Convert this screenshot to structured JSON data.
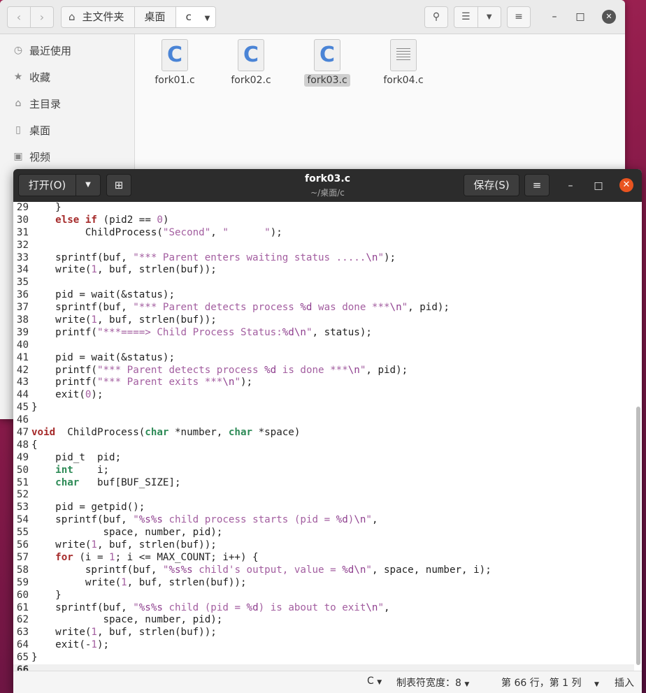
{
  "file_manager": {
    "path": [
      "主文件夹",
      "桌面",
      "c"
    ],
    "sidebar": [
      {
        "label": "最近使用",
        "icon": "clock-icon"
      },
      {
        "label": "收藏",
        "icon": "star-icon"
      },
      {
        "label": "主目录",
        "icon": "home-icon"
      },
      {
        "label": "桌面",
        "icon": "desktop-icon"
      },
      {
        "label": "视频",
        "icon": "video-icon"
      }
    ],
    "files": [
      {
        "name": "fork01.c",
        "type": "c"
      },
      {
        "name": "fork02.c",
        "type": "c"
      },
      {
        "name": "fork03.c",
        "type": "c",
        "selected": true
      },
      {
        "name": "fork04.c",
        "type": "text"
      }
    ]
  },
  "editor": {
    "open_label": "打开(O)",
    "save_label": "保存(S)",
    "title": "fork03.c",
    "subtitle": "~/桌面/c",
    "status": {
      "language": "C",
      "tab_width": "制表符宽度：8",
      "position": "第 66 行，第 1 列",
      "mode": "插入"
    },
    "lines": [
      {
        "n": "29",
        "code": "    }"
      },
      {
        "n": "30",
        "code": "    else if (pid2 == 0)"
      },
      {
        "n": "31",
        "code": "         ChildProcess(\"Second\", \"      \");"
      },
      {
        "n": "32",
        "code": ""
      },
      {
        "n": "33",
        "code": "    sprintf(buf, \"*** Parent enters waiting status .....\\n\");"
      },
      {
        "n": "34",
        "code": "    write(1, buf, strlen(buf));"
      },
      {
        "n": "35",
        "code": ""
      },
      {
        "n": "36",
        "code": "    pid = wait(&status);"
      },
      {
        "n": "37",
        "code": "    sprintf(buf, \"*** Parent detects process %d was done ***\\n\", pid);"
      },
      {
        "n": "38",
        "code": "    write(1, buf, strlen(buf));"
      },
      {
        "n": "39",
        "code": "    printf(\"***====> Child Process Status:%d\\n\", status);"
      },
      {
        "n": "40",
        "code": ""
      },
      {
        "n": "41",
        "code": "    pid = wait(&status);"
      },
      {
        "n": "42",
        "code": "    printf(\"*** Parent detects process %d is done ***\\n\", pid);"
      },
      {
        "n": "43",
        "code": "    printf(\"*** Parent exits ***\\n\");"
      },
      {
        "n": "44",
        "code": "    exit(0);"
      },
      {
        "n": "45",
        "code": "}"
      },
      {
        "n": "46",
        "code": ""
      },
      {
        "n": "47",
        "code": "void  ChildProcess(char *number, char *space)"
      },
      {
        "n": "48",
        "code": "{"
      },
      {
        "n": "49",
        "code": "    pid_t  pid;"
      },
      {
        "n": "50",
        "code": "    int    i;"
      },
      {
        "n": "51",
        "code": "    char   buf[BUF_SIZE];"
      },
      {
        "n": "52",
        "code": ""
      },
      {
        "n": "53",
        "code": "    pid = getpid();"
      },
      {
        "n": "54",
        "code": "    sprintf(buf, \"%s%s child process starts (pid = %d)\\n\","
      },
      {
        "n": "55",
        "code": "            space, number, pid);"
      },
      {
        "n": "56",
        "code": "    write(1, buf, strlen(buf));"
      },
      {
        "n": "57",
        "code": "    for (i = 1; i <= MAX_COUNT; i++) {"
      },
      {
        "n": "58",
        "code": "         sprintf(buf, \"%s%s child's output, value = %d\\n\", space, number, i);"
      },
      {
        "n": "59",
        "code": "         write(1, buf, strlen(buf));"
      },
      {
        "n": "60",
        "code": "    }"
      },
      {
        "n": "61",
        "code": "    sprintf(buf, \"%s%s child (pid = %d) is about to exit\\n\","
      },
      {
        "n": "62",
        "code": "            space, number, pid);"
      },
      {
        "n": "63",
        "code": "    write(1, buf, strlen(buf));"
      },
      {
        "n": "64",
        "code": "    exit(-1);"
      },
      {
        "n": "65",
        "code": "}"
      },
      {
        "n": "66",
        "code": "",
        "current": true
      }
    ]
  }
}
